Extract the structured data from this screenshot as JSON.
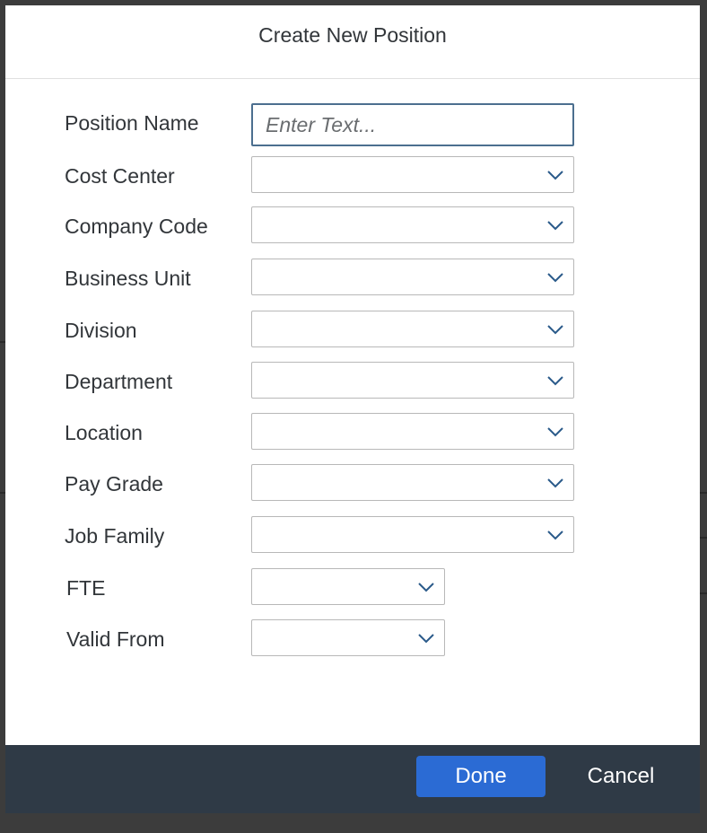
{
  "dialog": {
    "title": "Create New Position"
  },
  "form": {
    "position_name": {
      "label": "Position Name",
      "value": "",
      "placeholder": "Enter Text..."
    },
    "cost_center": {
      "label": "Cost Center",
      "value": ""
    },
    "company_code": {
      "label": "Company Code",
      "value": ""
    },
    "business_unit": {
      "label": "Business Unit",
      "value": ""
    },
    "division": {
      "label": "Division",
      "value": ""
    },
    "department": {
      "label": "Department",
      "value": ""
    },
    "location": {
      "label": "Location",
      "value": ""
    },
    "pay_grade": {
      "label": "Pay Grade",
      "value": ""
    },
    "job_family": {
      "label": "Job Family",
      "value": ""
    },
    "fte": {
      "label": "FTE",
      "value": ""
    },
    "valid_from": {
      "label": "Valid From",
      "value": ""
    }
  },
  "footer": {
    "done_label": "Done",
    "cancel_label": "Cancel"
  },
  "colors": {
    "accent": "#2b6bd4",
    "footer_bg": "#2f3a46",
    "input_focus_border": "#4c6f8f",
    "chevron": "#2a5a8a"
  },
  "icons": {
    "dropdown": "chevron-down-icon"
  }
}
